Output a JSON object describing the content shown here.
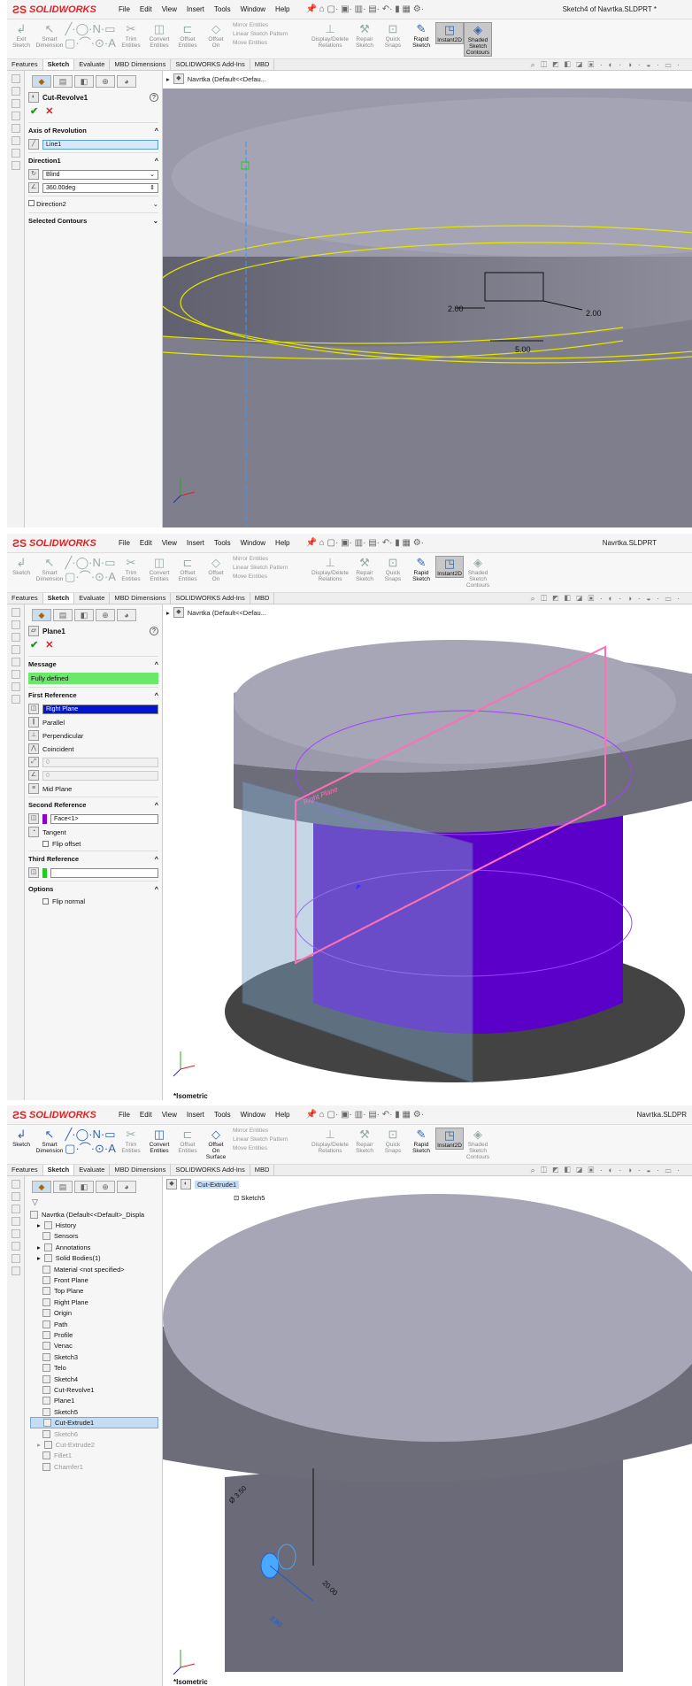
{
  "app": {
    "brand": "SOLIDWORKS",
    "menus": [
      "File",
      "Edit",
      "View",
      "Insert",
      "Tools",
      "Window",
      "Help"
    ]
  },
  "ribbon": {
    "tools1": [
      [
        "Exit",
        "Sketch"
      ],
      [
        "Smart",
        "Dimension"
      ]
    ],
    "tools1b": [
      [
        "Sketch",
        ""
      ],
      [
        "Smart",
        "Dimension"
      ]
    ],
    "trim": [
      "Trim",
      "Entities"
    ],
    "convert": [
      "Convert",
      "Entities"
    ],
    "offset": [
      "Offset",
      "Entities"
    ],
    "offsetsurf": [
      "Offset",
      "On",
      "Surface"
    ],
    "mirror": "Mirror Entities",
    "linear": "Linear Sketch Pattern",
    "move": "Move Entities",
    "display": [
      "Display/Delete",
      "Relations"
    ],
    "repair": [
      "Repair",
      "Sketch"
    ],
    "quick": [
      "Quick",
      "Snaps"
    ],
    "rapid": [
      "Rapid",
      "Sketch"
    ],
    "instant": "Instant2D",
    "shaded": [
      "Shaded",
      "Sketch",
      "Contours"
    ]
  },
  "tabs": [
    "Features",
    "Sketch",
    "Evaluate",
    "MBD Dimensions",
    "SOLIDWORKS Add-Ins",
    "MBD"
  ],
  "view_icons": "⌕ ◫ ◩ ◧ ◪ ▣ · ◐ · ◑ · ◒ · ▭ ·",
  "panel1": {
    "doc_title": "Sketch4 of Navrtka.SLDPRT *",
    "breadcrumb": "Navrtka  (Default<<Defau...",
    "feature": "Cut-Revolve1",
    "axis_header": "Axis of Revolution",
    "axis_value": "Line1",
    "dir1_header": "Direction1",
    "dir1_type": "Blind",
    "angle": "360.00deg",
    "dir2": "Direction2",
    "contours": "Selected Contours",
    "dims": {
      "d1": "2.00",
      "d2": "2.00",
      "d3": "5.00"
    }
  },
  "panel2": {
    "doc_title": "Navrtka.SLDPRT",
    "breadcrumb": "Navrtka  (Default<<Defau...",
    "feature": "Plane1",
    "message_header": "Message",
    "message": "Fully defined",
    "first_ref": "First Reference",
    "first_ref_value": "Right Plane",
    "constraints": [
      "Parallel",
      "Perpendicular",
      "Coincident"
    ],
    "distance": "0",
    "angle": "0",
    "mid_plane": "Mid Plane",
    "second_ref": "Second Reference",
    "second_ref_value": "Face<1>",
    "tangent": "Tangent",
    "flip_offset": "Flip offset",
    "third_ref": "Third Reference",
    "options": "Options",
    "flip_normal": "Flip normal",
    "plane_label": "Right Plane",
    "view_label": "*Isometric"
  },
  "panel3": {
    "doc_title": "Navrtka.SLDPR",
    "crumb": "Cut-Extrude1",
    "sketch": "Sketch5",
    "root": "Navrtka  (Default<<Default>_Displa",
    "items": [
      {
        "label": "History",
        "state": ""
      },
      {
        "label": "Sensors",
        "state": ""
      },
      {
        "label": "Annotations",
        "state": ""
      },
      {
        "label": "Solid Bodies(1)",
        "state": ""
      },
      {
        "label": "Material <not specified>",
        "state": ""
      },
      {
        "label": "Front Plane",
        "state": ""
      },
      {
        "label": "Top Plane",
        "state": ""
      },
      {
        "label": "Right Plane",
        "state": ""
      },
      {
        "label": "Origin",
        "state": ""
      },
      {
        "label": "Path",
        "state": ""
      },
      {
        "label": "Profile",
        "state": ""
      },
      {
        "label": "Venac",
        "state": ""
      },
      {
        "label": "Sketch3",
        "state": ""
      },
      {
        "label": "Telo",
        "state": ""
      },
      {
        "label": "Sketch4",
        "state": ""
      },
      {
        "label": "Cut-Revolve1",
        "state": ""
      },
      {
        "label": "Plane1",
        "state": ""
      },
      {
        "label": "Sketch5",
        "state": ""
      },
      {
        "label": "Cut-Extrude1",
        "state": "hl"
      },
      {
        "label": "Sketch6",
        "state": "gray"
      },
      {
        "label": "Cut-Extrude2",
        "state": "gray"
      },
      {
        "label": "Fillet1",
        "state": "gray"
      },
      {
        "label": "Chamfer1",
        "state": "gray"
      }
    ],
    "dims": {
      "dia": "Ø 3.50",
      "len": "20.00",
      "d": "3.80"
    },
    "view_label": "*Isometric"
  }
}
